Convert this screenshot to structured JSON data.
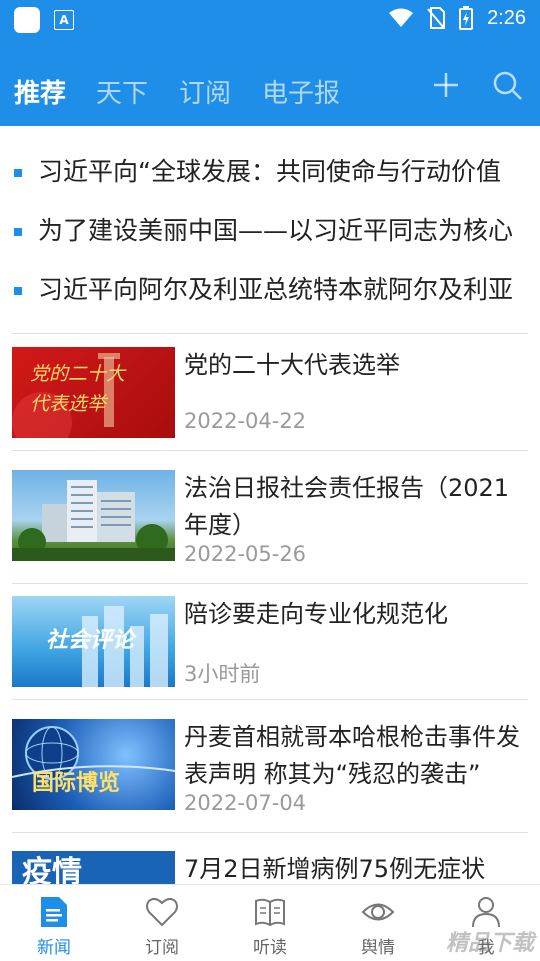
{
  "status_bar": {
    "time": "2:26"
  },
  "top_tabs": [
    {
      "label": "推荐"
    },
    {
      "label": "天下"
    },
    {
      "label": "订阅"
    },
    {
      "label": "电子报"
    }
  ],
  "headlines": [
    "习近平向“全球发展：共同使命与行动价值",
    "为了建设美丽中国——以习近平同志为核心",
    "习近平向阿尔及利亚总统特本就阿尔及利亚"
  ],
  "news": [
    {
      "title": "党的二十大代表选举",
      "date": "2022-04-22",
      "thumb_text": "党的二十大\n代表选举"
    },
    {
      "title": "法治日报社会责任报告（2021年度）",
      "date": "2022-05-26",
      "thumb_text": ""
    },
    {
      "title": "陪诊要走向专业化规范化",
      "date": "3小时前",
      "thumb_text": "社会评论"
    },
    {
      "title": "丹麦首相就哥本哈根枪击事件发表声明 称其为“残忍的袭击”",
      "date": "2022-07-04",
      "thumb_text": "国际博览"
    },
    {
      "title": "7月2日新增病例75例无症状",
      "date": "",
      "thumb_text": "疫情"
    }
  ],
  "bottom_nav": [
    {
      "label": "新闻",
      "icon": "news-icon"
    },
    {
      "label": "订阅",
      "icon": "heart-icon"
    },
    {
      "label": "听读",
      "icon": "book-icon"
    },
    {
      "label": "舆情",
      "icon": "eye-icon"
    },
    {
      "label": "我",
      "icon": "person-icon"
    }
  ],
  "watermark": "精品下载",
  "colors": {
    "accent": "#1f8ee8"
  }
}
